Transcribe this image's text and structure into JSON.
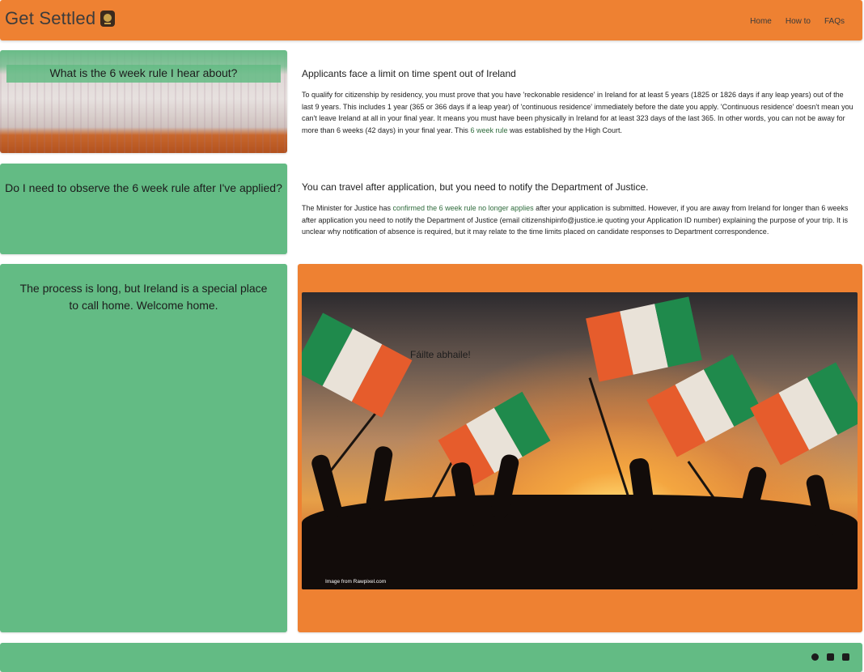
{
  "header": {
    "brand": "Get Settled",
    "nav": [
      "Home",
      "How to",
      "FAQs"
    ]
  },
  "q1": {
    "question": "What is the 6 week rule I hear about?",
    "heading": "Applicants face a limit on time spent out of Ireland",
    "body": "To qualify for citizenship by residency, you must prove that you have 'reckonable residence' in Ireland for at least 5 years (1825 or 1826 days if any leap years) out of the last 9 years. This includes 1 year (365 or 366 days if a leap year) of 'continuous residence' immediately before the date you apply. 'Continuous residence' doesn't mean you can't leave Ireland at all in your final year. It means you must have been physically in Ireland for at least 323 days of the last 365. In other words, you can not be away for more than 6 weeks (42 days) in your final year. This ",
    "link": "6 week rule",
    "body_end": " was established by the High Court."
  },
  "q2": {
    "question": "Do I need to observe the 6 week rule after I've applied?",
    "heading": "You can travel after application, but you need to notify the Department of Justice.",
    "body_start": "The Minister for Justice has ",
    "link": "confirmed the 6 week rule no longer applies",
    "body_end": " after your application is submitted. However, if you are away from Ireland for longer than 6 weeks after application you need to notify the Department of Justice (email citizenshipinfo@justice.ie quoting your Application ID number) explaining the purpose of your trip. It is unclear why notification of absence is required, but it may relate to the time limits placed on candidate responses to Department correspondence."
  },
  "q3": {
    "message": "The process is long, but Ireland is a special place to call home. Welcome home."
  },
  "photo": {
    "caption": "Fáilte abhaile!",
    "credit": "Image from Rawpixel.com"
  },
  "colors": {
    "orange": "#ee8132",
    "green": "#63bb84"
  },
  "footer": {
    "icons": [
      "facebook-icon",
      "youtube-icon",
      "instagram-icon"
    ]
  }
}
